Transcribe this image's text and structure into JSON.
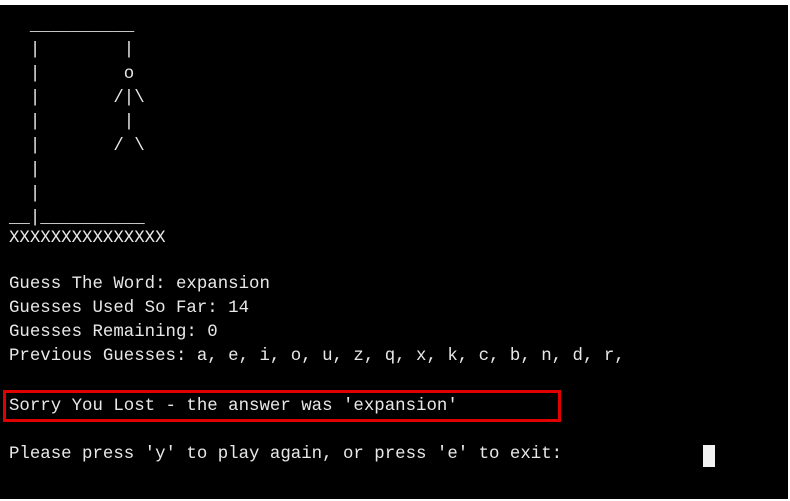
{
  "gallows": [
    "  __________",
    "  |        |",
    "  |        o",
    "  |       /|\\",
    "  |        |",
    "  |       / \\",
    "  |",
    "  |",
    "__|__________",
    "XXXXXXXXXXXXXXX"
  ],
  "status": {
    "guess_word": "Guess The Word: expansion",
    "guesses_used": "Guesses Used So Far: 14",
    "guesses_remaining": "Guesses Remaining: 0",
    "previous_guesses": "Previous Guesses: a, e, i, o, u, z, q, x, k, c, b, n, d, r,"
  },
  "result_message": "Sorry You Lost - the answer was 'expansion'",
  "prompt": "Please press 'y' to play again, or press 'e' to exit: ",
  "colors": {
    "background": "#000000",
    "text": "#e8e8e8",
    "highlight_border": "#e00000"
  }
}
